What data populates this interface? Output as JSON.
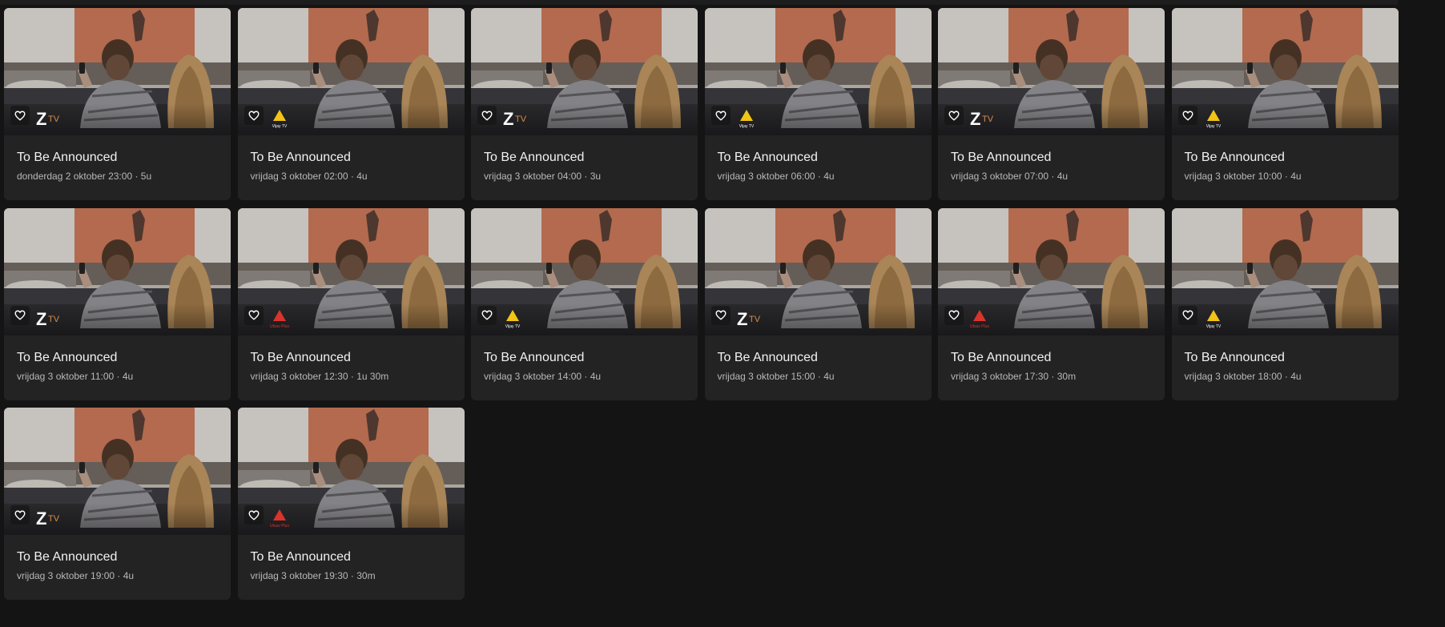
{
  "channels": {
    "ztv": {
      "text_z": "Z",
      "text_tv": "TV",
      "color": "#d98a4a",
      "icon": "z-tv-logo"
    },
    "vijay": {
      "text": "Vijay TV",
      "color": "#f2c318",
      "icon": "vijay-tv-logo"
    },
    "utsav": {
      "text": "Utsav Plus",
      "color": "#d8342c",
      "icon": "utsav-plus-logo"
    }
  },
  "colors": {
    "background": "#141414",
    "card": "#232323",
    "meta_text": "#b8b8b8"
  },
  "cards": [
    {
      "title": "To Be Announced",
      "meta": "donderdag 2 oktober 23:00 · 5u",
      "channel": "ztv"
    },
    {
      "title": "To Be Announced",
      "meta": "vrijdag 3 oktober 02:00 · 4u",
      "channel": "vijay"
    },
    {
      "title": "To Be Announced",
      "meta": "vrijdag 3 oktober 04:00 · 3u",
      "channel": "ztv"
    },
    {
      "title": "To Be Announced",
      "meta": "vrijdag 3 oktober 06:00 · 4u",
      "channel": "vijay"
    },
    {
      "title": "To Be Announced",
      "meta": "vrijdag 3 oktober 07:00 · 4u",
      "channel": "ztv"
    },
    {
      "title": "To Be Announced",
      "meta": "vrijdag 3 oktober 10:00 · 4u",
      "channel": "vijay"
    },
    {
      "title": "To Be Announced",
      "meta": "vrijdag 3 oktober 11:00 · 4u",
      "channel": "ztv"
    },
    {
      "title": "To Be Announced",
      "meta": "vrijdag 3 oktober 12:30 · 1u 30m",
      "channel": "utsav"
    },
    {
      "title": "To Be Announced",
      "meta": "vrijdag 3 oktober 14:00 · 4u",
      "channel": "vijay"
    },
    {
      "title": "To Be Announced",
      "meta": "vrijdag 3 oktober 15:00 · 4u",
      "channel": "ztv"
    },
    {
      "title": "To Be Announced",
      "meta": "vrijdag 3 oktober 17:30 · 30m",
      "channel": "utsav"
    },
    {
      "title": "To Be Announced",
      "meta": "vrijdag 3 oktober 18:00 · 4u",
      "channel": "vijay"
    },
    {
      "title": "To Be Announced",
      "meta": "vrijdag 3 oktober 19:00 · 4u",
      "channel": "ztv"
    },
    {
      "title": "To Be Announced",
      "meta": "vrijdag 3 oktober 19:30 · 30m",
      "channel": "utsav"
    }
  ]
}
